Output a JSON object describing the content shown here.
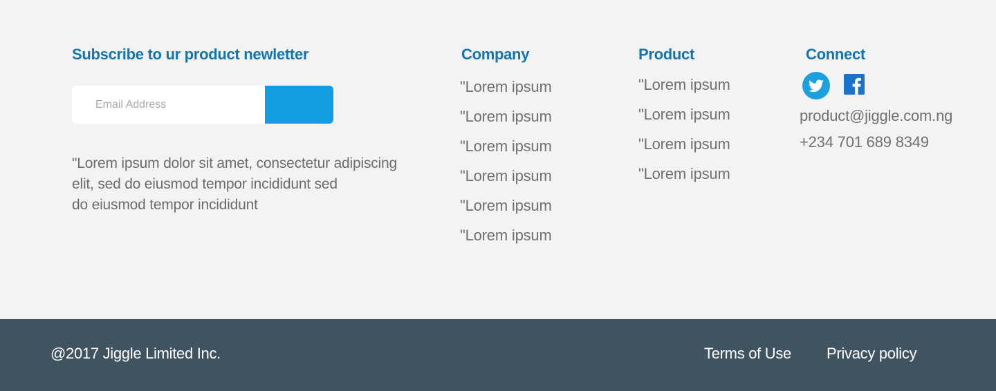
{
  "newsletter": {
    "heading": "Subscribe to ur product newletter",
    "email_placeholder": "Email Address",
    "email_value": "",
    "button_label": "",
    "blurb_lines": [
      "\"Lorem ipsum dolor sit amet, consectetur adipiscing",
      "elit, sed do eiusmod tempor incididunt sed",
      "do eiusmod tempor incididunt"
    ]
  },
  "company": {
    "heading": "Company",
    "links": [
      "\"Lorem ipsum",
      "\"Lorem ipsum",
      "\"Lorem ipsum",
      "\"Lorem ipsum",
      "\"Lorem ipsum",
      "\"Lorem ipsum"
    ]
  },
  "product": {
    "heading": "Product",
    "links": [
      "\"Lorem ipsum",
      "\"Lorem ipsum",
      "\"Lorem ipsum",
      "\"Lorem ipsum"
    ]
  },
  "connect": {
    "heading": "Connect",
    "icons": [
      "twitter-icon",
      "facebook-icon"
    ],
    "email": "product@jiggle.com.ng",
    "phone": "+234 701 689 8349"
  },
  "bottom_bar": {
    "copyright": "@2017 Jiggle Limited Inc.",
    "terms_label": "Terms of Use",
    "privacy_label": "Privacy policy"
  },
  "colors": {
    "heading": "#1474ad",
    "accent": "#139de0",
    "background": "#f3f3f3",
    "bottom_bar": "#405361",
    "body_text": "#707070"
  }
}
